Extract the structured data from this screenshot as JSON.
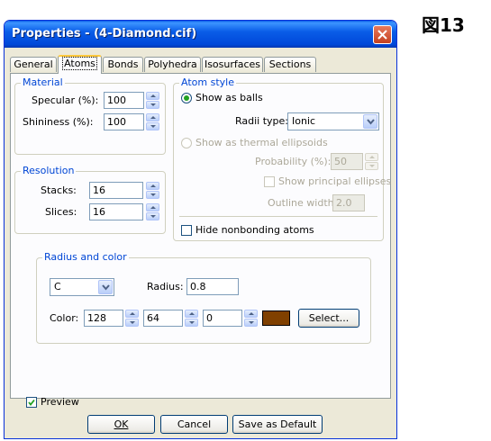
{
  "figure_label": "図13",
  "window": {
    "title": "Properties - (4-Diamond.cif)"
  },
  "tabs": [
    {
      "label": "General"
    },
    {
      "label": "Atoms"
    },
    {
      "label": "Bonds"
    },
    {
      "label": "Polyhedra"
    },
    {
      "label": "Isosurfaces"
    },
    {
      "label": "Sections"
    }
  ],
  "material": {
    "title": "Material",
    "specular_label": "Specular (%):",
    "specular_value": "100",
    "shininess_label": "Shininess (%):",
    "shininess_value": "100"
  },
  "resolution": {
    "title": "Resolution",
    "stacks_label": "Stacks:",
    "stacks_value": "16",
    "slices_label": "Slices:",
    "slices_value": "16"
  },
  "atom_style": {
    "title": "Atom style",
    "balls_label": "Show as balls",
    "radii_type_label": "Radii type:",
    "radii_type_value": "Ionic",
    "ellipsoids_label": "Show as thermal ellipsoids",
    "probability_label": "Probability (%):",
    "probability_value": "50",
    "principal_label": "Show principal ellipses",
    "outline_label": "Outline width:",
    "outline_value": "2.0",
    "hide_nonbonding_label": "Hide nonbonding atoms"
  },
  "radius_color": {
    "title": "Radius and color",
    "element_value": "C",
    "radius_label": "Radius:",
    "radius_value": "0.8",
    "color_label": "Color:",
    "r_value": "128",
    "g_value": "64",
    "b_value": "0",
    "swatch_color": "#804000",
    "select_label": "Select..."
  },
  "footer": {
    "preview_label": "Preview",
    "ok_label": "OK",
    "cancel_label": "Cancel",
    "save_default_label": "Save as Default"
  }
}
